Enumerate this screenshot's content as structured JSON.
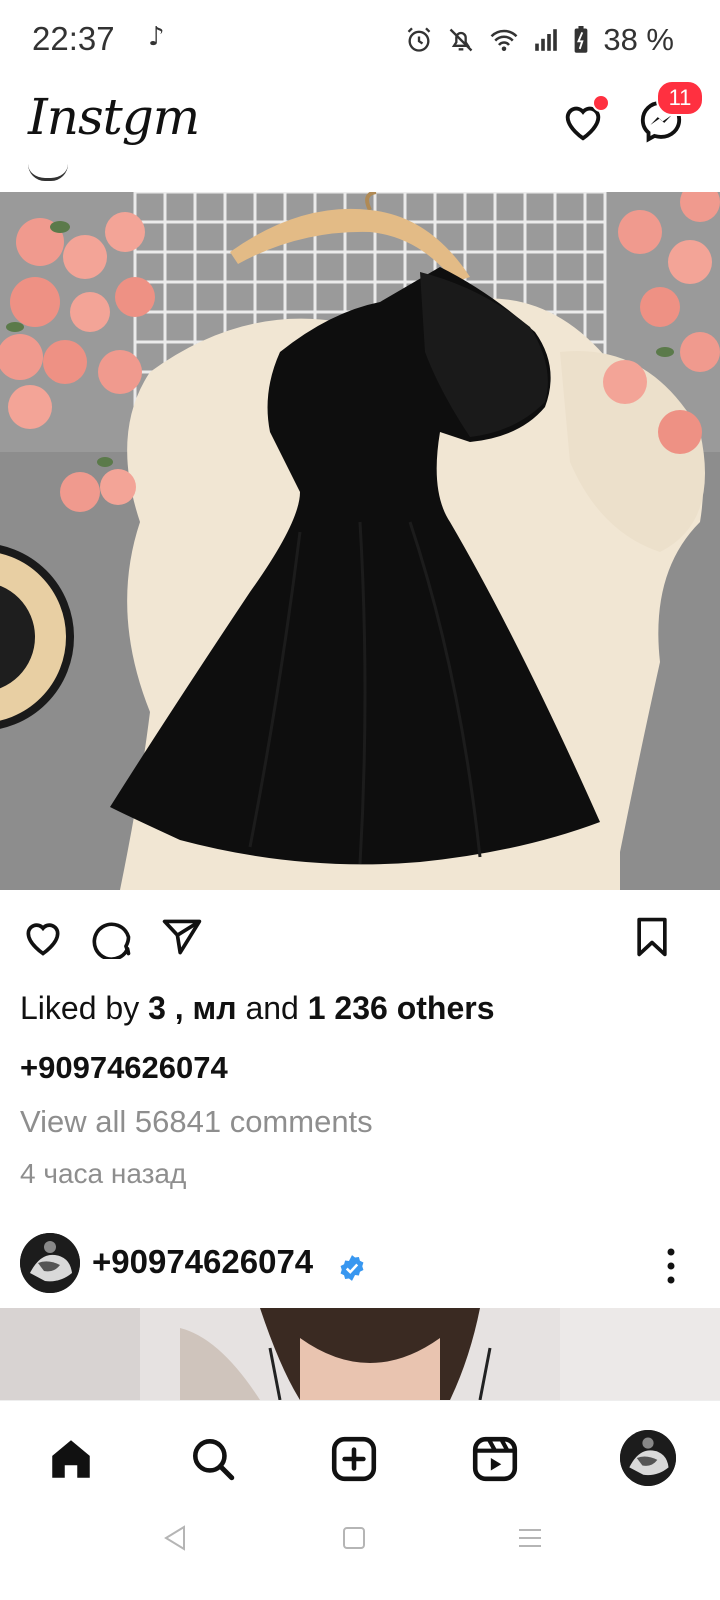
{
  "status_bar": {
    "time": "22:37",
    "music_glyph": "♪",
    "battery_text": "38 %",
    "icons": [
      "alarm-icon",
      "bell-off-icon",
      "wifi-icon",
      "signal-icon",
      "battery-charging-icon"
    ]
  },
  "header": {
    "logo": "Instgm",
    "messages_badge": "11",
    "accent_color": "#ff3040"
  },
  "post": {
    "liked_prefix": "Liked by ",
    "liked_names": "3 , мл",
    "liked_and": " and ",
    "liked_others": "1 236 others",
    "owner": "+90974626074",
    "view_all": "View all  56841 comments",
    "time_ago": "4 часа назад"
  },
  "next_post": {
    "username": "+90974626074",
    "verified_color": "#3897f0"
  },
  "bottom_nav": {
    "items": [
      "home-icon",
      "search-icon",
      "create-icon",
      "reels-icon",
      "profile-avatar"
    ]
  }
}
